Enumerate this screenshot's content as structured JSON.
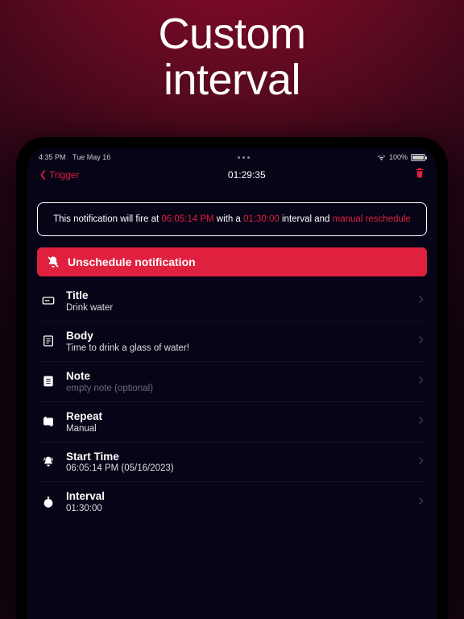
{
  "hero": {
    "line1": "Custom",
    "line2": "interval"
  },
  "statusbar": {
    "time": "4:35 PM",
    "date": "Tue May 16",
    "wifi_percent": "100%"
  },
  "nav": {
    "back_label": "Trigger",
    "title": "01:29:35"
  },
  "infobox": {
    "t1": "This notification will fire at ",
    "fire_time": "06:05:14 PM",
    "t2": " with a ",
    "interval": "01:30:00",
    "t3": " interval and ",
    "mode": "manual reschedule"
  },
  "unschedule": {
    "label": "Unschedule notification"
  },
  "rows": {
    "title": {
      "label": "Title",
      "value": "Drink water"
    },
    "body": {
      "label": "Body",
      "value": "Time to drink a glass of water!"
    },
    "note": {
      "label": "Note",
      "placeholder": "empty note (optional)"
    },
    "repeat": {
      "label": "Repeat",
      "value": "Manual"
    },
    "start_time": {
      "label": "Start Time",
      "value": "06:05:14 PM (05/16/2023)"
    },
    "interval": {
      "label": "Interval",
      "value": "01:30:00"
    }
  }
}
